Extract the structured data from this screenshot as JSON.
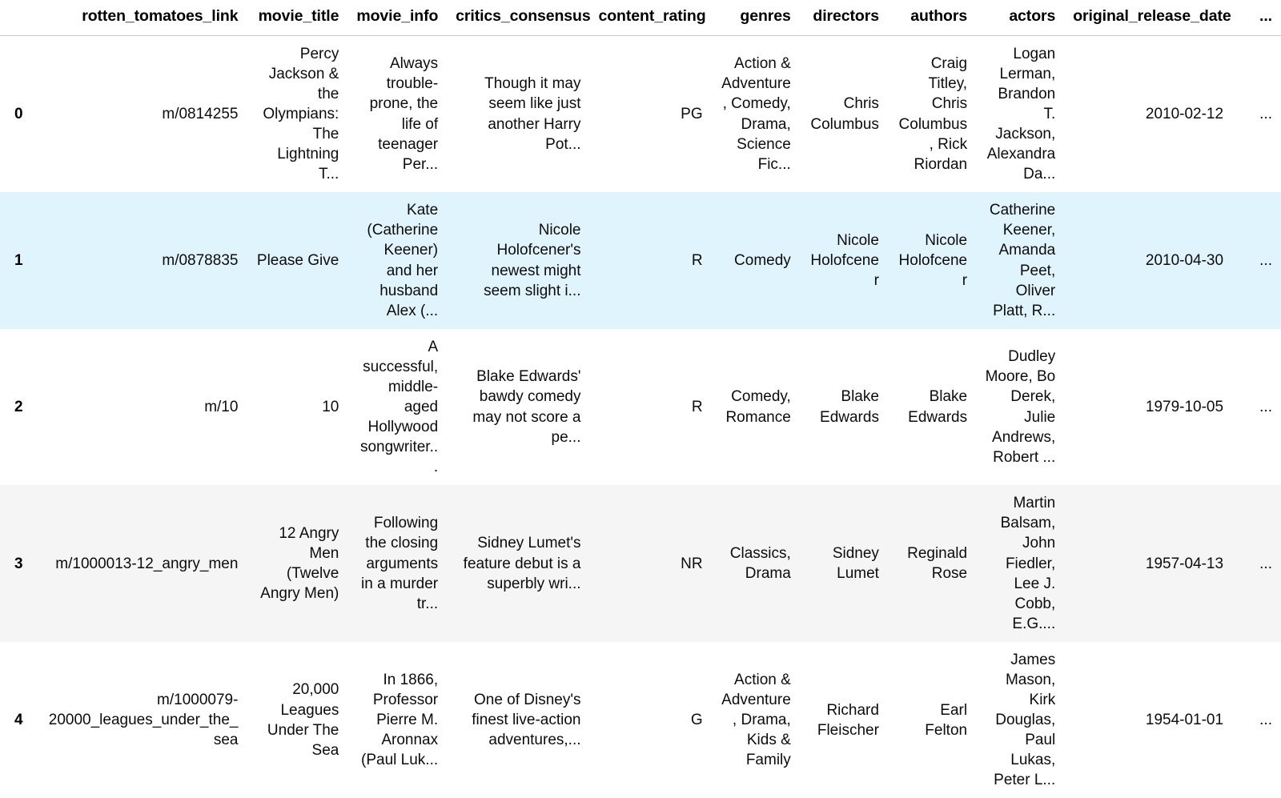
{
  "table": {
    "index_header": "",
    "columns": [
      "rotten_tomatoes_link",
      "movie_title",
      "movie_info",
      "critics_consensus",
      "content_rating",
      "genres",
      "directors",
      "authors",
      "actors",
      "original_release_date",
      "..."
    ],
    "rows": [
      {
        "index": "0",
        "state": "default",
        "cells": [
          "m/0814255",
          "Percy Jackson & the Olympians: The Lightning T...",
          "Always trouble-prone, the life of teenager Per...",
          "Though it may seem like just another Harry Pot...",
          "PG",
          "Action & Adventure, Comedy, Drama, Science Fic...",
          "Chris Columbus",
          "Craig Titley, Chris Columbus, Rick Riordan",
          "Logan Lerman, Brandon T. Jackson, Alexandra Da...",
          "2010-02-12",
          "..."
        ]
      },
      {
        "index": "1",
        "state": "selected",
        "cells": [
          "m/0878835",
          "Please Give",
          "Kate (Catherine Keener) and her husband Alex (...",
          "Nicole Holofcener's newest might seem slight i...",
          "R",
          "Comedy",
          "Nicole Holofcener",
          "Nicole Holofcener",
          "Catherine Keener, Amanda Peet, Oliver Platt, R...",
          "2010-04-30",
          "..."
        ]
      },
      {
        "index": "2",
        "state": "default",
        "cells": [
          "m/10",
          "10",
          "A successful, middle-aged Hollywood songwriter...",
          "Blake Edwards' bawdy comedy may not score a pe...",
          "R",
          "Comedy, Romance",
          "Blake Edwards",
          "Blake Edwards",
          "Dudley Moore, Bo Derek, Julie Andrews, Robert ...",
          "1979-10-05",
          "..."
        ]
      },
      {
        "index": "3",
        "state": "striped",
        "cells": [
          "m/1000013-12_angry_men",
          "12 Angry Men (Twelve Angry Men)",
          "Following the closing arguments in a murder tr...",
          "Sidney Lumet's feature debut is a superbly wri...",
          "NR",
          "Classics, Drama",
          "Sidney Lumet",
          "Reginald Rose",
          "Martin Balsam, John Fiedler, Lee J. Cobb, E.G....",
          "1957-04-13",
          "..."
        ]
      },
      {
        "index": "4",
        "state": "default",
        "cells": [
          "m/1000079-20000_leagues_under_the_sea",
          "20,000 Leagues Under The Sea",
          "In 1866, Professor Pierre M. Aronnax (Paul Luk...",
          "One of Disney's finest live-action adventures,...",
          "G",
          "Action & Adventure, Drama, Kids & Family",
          "Richard Fleischer",
          "Earl Felton",
          "James Mason, Kirk Douglas, Paul Lukas, Peter L...",
          "1954-01-01",
          "..."
        ]
      }
    ]
  },
  "colors": {
    "selected_row": "#e0f4fd",
    "striped_row": "#f5f5f5",
    "background": "#ffffff",
    "header_rule": "#c9c9c9",
    "text": "#000000"
  }
}
